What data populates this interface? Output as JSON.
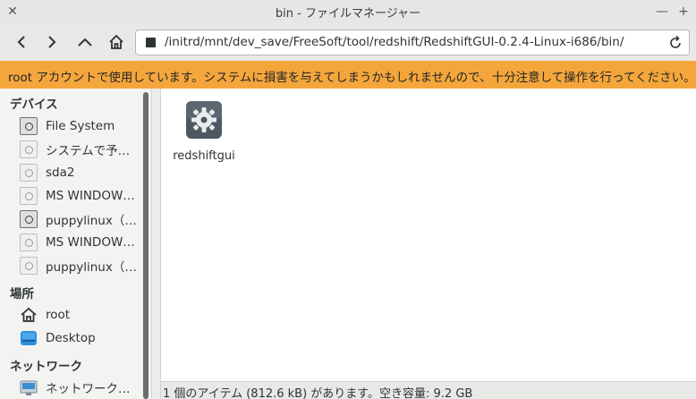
{
  "window": {
    "title": "bin - ファイルマネージャー",
    "close_glyph": "✕",
    "minimize_glyph": "—",
    "maximize_glyph": "+"
  },
  "toolbar": {
    "back_icon": "back-arrow-icon",
    "forward_icon": "forward-arrow-icon",
    "up_icon": "up-arrow-icon",
    "home_icon": "home-icon",
    "path": "/initrd/mnt/dev_save/FreeSoft/tool/redshift/RedshiftGUI-0.2.4-Linux-i686/bin/"
  },
  "warning": {
    "text": "root アカウントで使用しています。システムに損害を与えてしまうかもしれませんので、十分注意して操作を行ってください。",
    "color": "#f4a63c"
  },
  "sidebar": {
    "devices_heading": "デバイス",
    "devices": [
      {
        "label": "File System",
        "active": true
      },
      {
        "label": "システムで予…",
        "active": false
      },
      {
        "label": "sda2",
        "active": false
      },
      {
        "label": "MS WINDOW…",
        "active": false
      },
      {
        "label": "puppylinux（…",
        "active": true
      },
      {
        "label": "MS WINDOW…",
        "active": false
      },
      {
        "label": "puppylinux（…",
        "active": false
      }
    ],
    "places_heading": "場所",
    "places": [
      {
        "label": "root",
        "icon": "home-icon"
      },
      {
        "label": "Desktop",
        "icon": "desktop-icon"
      }
    ],
    "network_heading": "ネットワーク",
    "network": [
      {
        "label": "ネットワーク…",
        "icon": "network-icon"
      }
    ]
  },
  "content": {
    "files": [
      {
        "name": "redshiftgui",
        "icon": "executable-gear-icon"
      }
    ]
  },
  "status": {
    "text": "1 個のアイテム (812.6 kB) があります。空き容量: 9.2 GB"
  }
}
